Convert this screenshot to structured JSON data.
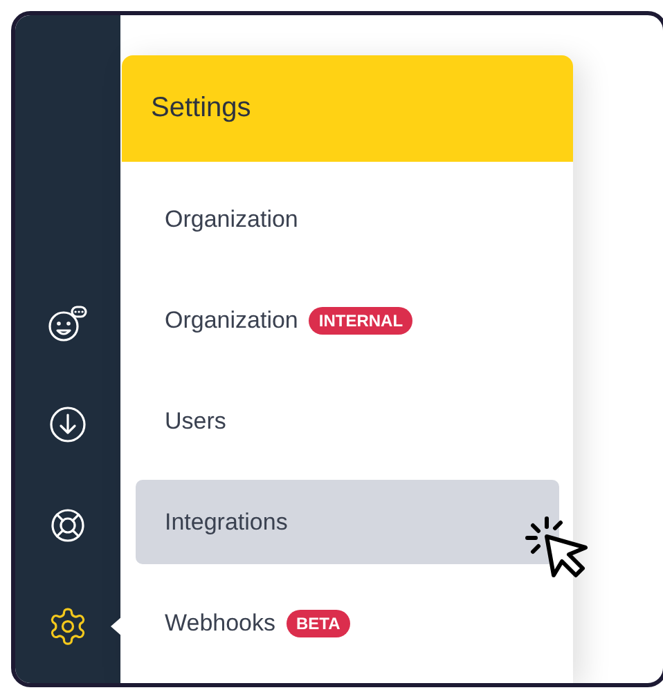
{
  "sidebar": {
    "items": [
      {
        "kind": "chat",
        "selected": false
      },
      {
        "kind": "download",
        "selected": false
      },
      {
        "kind": "help",
        "selected": false
      },
      {
        "kind": "settings",
        "selected": true
      }
    ]
  },
  "menu": {
    "title": "Settings",
    "items": [
      {
        "label": "Organization",
        "selected": false
      },
      {
        "label": "Organization",
        "badge": "INTERNAL",
        "selected": false
      },
      {
        "label": "Users",
        "selected": false
      },
      {
        "label": "Integrations",
        "selected": true
      },
      {
        "label": "Webhooks",
        "badge": "BETA",
        "selected": false
      }
    ]
  }
}
